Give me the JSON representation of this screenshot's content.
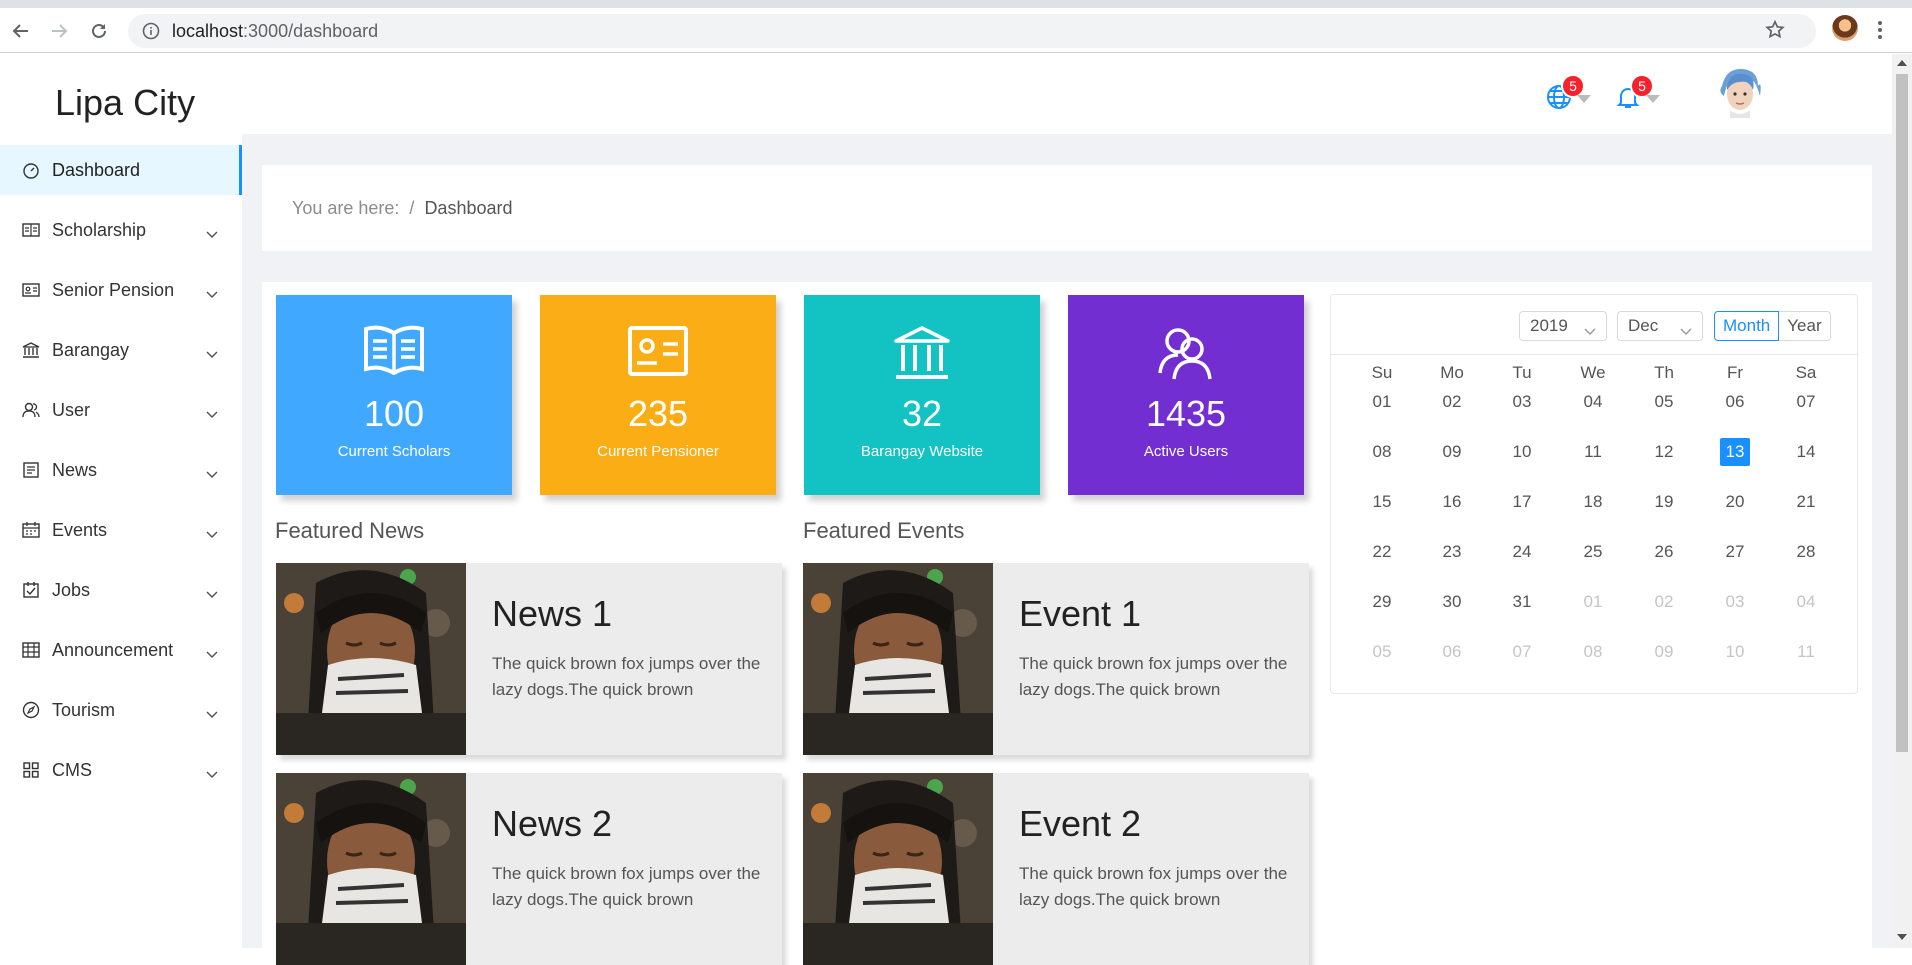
{
  "browser": {
    "url_host": "localhost",
    "url_path": ":3000/dashboard"
  },
  "header": {
    "brand": "Lipa City",
    "globe_badge": "5",
    "bell_badge": "5"
  },
  "sidebar": {
    "items": [
      {
        "label": "Dashboard",
        "icon": "dashboard-icon",
        "active": true
      },
      {
        "label": "Scholarship",
        "icon": "book-icon"
      },
      {
        "label": "Senior Pension",
        "icon": "id-card-icon"
      },
      {
        "label": "Barangay",
        "icon": "bank-icon"
      },
      {
        "label": "User",
        "icon": "user-icon"
      },
      {
        "label": "News",
        "icon": "news-icon"
      },
      {
        "label": "Events",
        "icon": "calendar-icon"
      },
      {
        "label": "Jobs",
        "icon": "jobs-icon"
      },
      {
        "label": "Announcement",
        "icon": "table-icon"
      },
      {
        "label": "Tourism",
        "icon": "compass-icon"
      },
      {
        "label": "CMS",
        "icon": "grid-icon"
      }
    ]
  },
  "breadcrumb": {
    "prefix": "You are here:",
    "separator": "/",
    "current": "Dashboard"
  },
  "stats": [
    {
      "value": "100",
      "label": "Current Scholars",
      "icon": "open-book-icon",
      "color": "#40a9ff"
    },
    {
      "value": "235",
      "label": "Current Pensioner",
      "icon": "id-card-icon",
      "color": "#faad14"
    },
    {
      "value": "32",
      "label": "Barangay Website",
      "icon": "bank-icon",
      "color": "#13c2c2"
    },
    {
      "value": "1435",
      "label": "Active Users",
      "icon": "team-icon",
      "color": "#722ed1"
    }
  ],
  "featured_news": {
    "title": "Featured News",
    "items": [
      {
        "title": "News 1",
        "text": "The quick brown fox jumps over the lazy dogs.The quick brown"
      },
      {
        "title": "News 2",
        "text": "The quick brown fox jumps over the lazy dogs.The quick brown"
      }
    ]
  },
  "featured_events": {
    "title": "Featured Events",
    "items": [
      {
        "title": "Event 1",
        "text": "The quick brown fox jumps over the lazy dogs.The quick brown"
      },
      {
        "title": "Event 2",
        "text": "The quick brown fox jumps over the lazy dogs.The quick brown"
      }
    ]
  },
  "calendar": {
    "year": "2019",
    "month": "Dec",
    "mode_month": "Month",
    "mode_year": "Year",
    "weekdays": [
      "Su",
      "Mo",
      "Tu",
      "We",
      "Th",
      "Fr",
      "Sa"
    ],
    "weeks": [
      [
        "01",
        "02",
        "03",
        "04",
        "05",
        "06",
        "07"
      ],
      [
        "08",
        "09",
        "10",
        "11",
        "12",
        "13",
        "14"
      ],
      [
        "15",
        "16",
        "17",
        "18",
        "19",
        "20",
        "21"
      ],
      [
        "22",
        "23",
        "24",
        "25",
        "26",
        "27",
        "28"
      ],
      [
        "29",
        "30",
        "31",
        "01",
        "02",
        "03",
        "04"
      ],
      [
        "05",
        "06",
        "07",
        "08",
        "09",
        "10",
        "11"
      ]
    ],
    "selected": "13",
    "accent": "#1890ff"
  }
}
